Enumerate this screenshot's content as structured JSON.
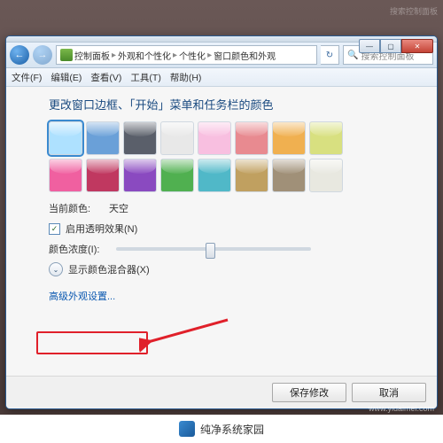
{
  "watermark_top": "搜索控制面板",
  "breadcrumb": {
    "root": "控制面板",
    "level1": "外观和个性化",
    "level2": "个性化",
    "level3": "窗口颜色和外观",
    "sep": "▸"
  },
  "search": {
    "placeholder": "搜索控制面板",
    "icon": "🔍"
  },
  "win_controls": {
    "min": "—",
    "max": "▢",
    "close": "✕"
  },
  "menubar": {
    "file": "文件(F)",
    "edit": "编辑(E)",
    "view": "查看(V)",
    "tools": "工具(T)",
    "help": "帮助(H)"
  },
  "heading": "更改窗口边框、「开始」菜单和任务栏的颜色",
  "swatches": [
    {
      "c": "#aee1ff",
      "sel": true
    },
    {
      "c": "#6aa0d8"
    },
    {
      "c": "#5a5f6a"
    },
    {
      "c": "#e8e8e8"
    },
    {
      "c": "#f8bfe0"
    },
    {
      "c": "#e88a90"
    },
    {
      "c": "#f0b050"
    },
    {
      "c": "#d8e080"
    },
    {
      "c": "#f060a0"
    },
    {
      "c": "#c03860"
    },
    {
      "c": "#8a4ac0"
    },
    {
      "c": "#50b050"
    },
    {
      "c": "#50b8c8"
    },
    {
      "c": "#c0a060"
    },
    {
      "c": "#a09078"
    },
    {
      "c": "#e8e8e0"
    }
  ],
  "current_color": {
    "label": "当前颜色:",
    "value": "天空"
  },
  "transparency": {
    "label": "启用透明效果(N)",
    "checked": "✓"
  },
  "intensity": {
    "label": "颜色浓度(I):",
    "value_pct": 48
  },
  "mixer": {
    "label": "显示颜色混合器(X)",
    "chevron": "⌄"
  },
  "adv_link": "高级外观设置...",
  "footer": {
    "save": "保存修改",
    "cancel": "取消"
  },
  "branding": {
    "name": "纯净系统家园",
    "url": "www.yidaimei.com"
  },
  "nav": {
    "back": "←",
    "fwd": "→"
  }
}
